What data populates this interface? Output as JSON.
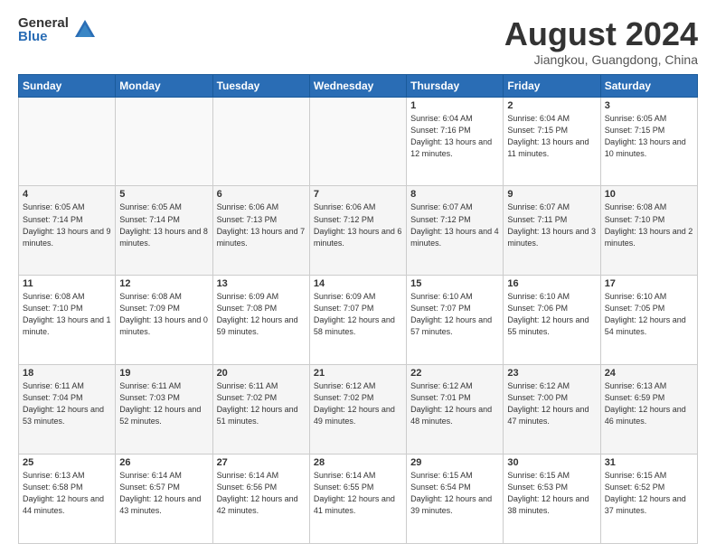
{
  "logo": {
    "general": "General",
    "blue": "Blue"
  },
  "header": {
    "month": "August 2024",
    "location": "Jiangkou, Guangdong, China"
  },
  "days_of_week": [
    "Sunday",
    "Monday",
    "Tuesday",
    "Wednesday",
    "Thursday",
    "Friday",
    "Saturday"
  ],
  "weeks": [
    [
      {
        "day": "",
        "empty": true
      },
      {
        "day": "",
        "empty": true
      },
      {
        "day": "",
        "empty": true
      },
      {
        "day": "",
        "empty": true
      },
      {
        "day": "1",
        "sunrise": "6:04 AM",
        "sunset": "7:16 PM",
        "daylight": "13 hours and 12 minutes."
      },
      {
        "day": "2",
        "sunrise": "6:04 AM",
        "sunset": "7:15 PM",
        "daylight": "13 hours and 11 minutes."
      },
      {
        "day": "3",
        "sunrise": "6:05 AM",
        "sunset": "7:15 PM",
        "daylight": "13 hours and 10 minutes."
      }
    ],
    [
      {
        "day": "4",
        "sunrise": "6:05 AM",
        "sunset": "7:14 PM",
        "daylight": "13 hours and 9 minutes."
      },
      {
        "day": "5",
        "sunrise": "6:05 AM",
        "sunset": "7:14 PM",
        "daylight": "13 hours and 8 minutes."
      },
      {
        "day": "6",
        "sunrise": "6:06 AM",
        "sunset": "7:13 PM",
        "daylight": "13 hours and 7 minutes."
      },
      {
        "day": "7",
        "sunrise": "6:06 AM",
        "sunset": "7:12 PM",
        "daylight": "13 hours and 6 minutes."
      },
      {
        "day": "8",
        "sunrise": "6:07 AM",
        "sunset": "7:12 PM",
        "daylight": "13 hours and 4 minutes."
      },
      {
        "day": "9",
        "sunrise": "6:07 AM",
        "sunset": "7:11 PM",
        "daylight": "13 hours and 3 minutes."
      },
      {
        "day": "10",
        "sunrise": "6:08 AM",
        "sunset": "7:10 PM",
        "daylight": "13 hours and 2 minutes."
      }
    ],
    [
      {
        "day": "11",
        "sunrise": "6:08 AM",
        "sunset": "7:10 PM",
        "daylight": "13 hours and 1 minute."
      },
      {
        "day": "12",
        "sunrise": "6:08 AM",
        "sunset": "7:09 PM",
        "daylight": "13 hours and 0 minutes."
      },
      {
        "day": "13",
        "sunrise": "6:09 AM",
        "sunset": "7:08 PM",
        "daylight": "12 hours and 59 minutes."
      },
      {
        "day": "14",
        "sunrise": "6:09 AM",
        "sunset": "7:07 PM",
        "daylight": "12 hours and 58 minutes."
      },
      {
        "day": "15",
        "sunrise": "6:10 AM",
        "sunset": "7:07 PM",
        "daylight": "12 hours and 57 minutes."
      },
      {
        "day": "16",
        "sunrise": "6:10 AM",
        "sunset": "7:06 PM",
        "daylight": "12 hours and 55 minutes."
      },
      {
        "day": "17",
        "sunrise": "6:10 AM",
        "sunset": "7:05 PM",
        "daylight": "12 hours and 54 minutes."
      }
    ],
    [
      {
        "day": "18",
        "sunrise": "6:11 AM",
        "sunset": "7:04 PM",
        "daylight": "12 hours and 53 minutes."
      },
      {
        "day": "19",
        "sunrise": "6:11 AM",
        "sunset": "7:03 PM",
        "daylight": "12 hours and 52 minutes."
      },
      {
        "day": "20",
        "sunrise": "6:11 AM",
        "sunset": "7:02 PM",
        "daylight": "12 hours and 51 minutes."
      },
      {
        "day": "21",
        "sunrise": "6:12 AM",
        "sunset": "7:02 PM",
        "daylight": "12 hours and 49 minutes."
      },
      {
        "day": "22",
        "sunrise": "6:12 AM",
        "sunset": "7:01 PM",
        "daylight": "12 hours and 48 minutes."
      },
      {
        "day": "23",
        "sunrise": "6:12 AM",
        "sunset": "7:00 PM",
        "daylight": "12 hours and 47 minutes."
      },
      {
        "day": "24",
        "sunrise": "6:13 AM",
        "sunset": "6:59 PM",
        "daylight": "12 hours and 46 minutes."
      }
    ],
    [
      {
        "day": "25",
        "sunrise": "6:13 AM",
        "sunset": "6:58 PM",
        "daylight": "12 hours and 44 minutes."
      },
      {
        "day": "26",
        "sunrise": "6:14 AM",
        "sunset": "6:57 PM",
        "daylight": "12 hours and 43 minutes."
      },
      {
        "day": "27",
        "sunrise": "6:14 AM",
        "sunset": "6:56 PM",
        "daylight": "12 hours and 42 minutes."
      },
      {
        "day": "28",
        "sunrise": "6:14 AM",
        "sunset": "6:55 PM",
        "daylight": "12 hours and 41 minutes."
      },
      {
        "day": "29",
        "sunrise": "6:15 AM",
        "sunset": "6:54 PM",
        "daylight": "12 hours and 39 minutes."
      },
      {
        "day": "30",
        "sunrise": "6:15 AM",
        "sunset": "6:53 PM",
        "daylight": "12 hours and 38 minutes."
      },
      {
        "day": "31",
        "sunrise": "6:15 AM",
        "sunset": "6:52 PM",
        "daylight": "12 hours and 37 minutes."
      }
    ]
  ]
}
